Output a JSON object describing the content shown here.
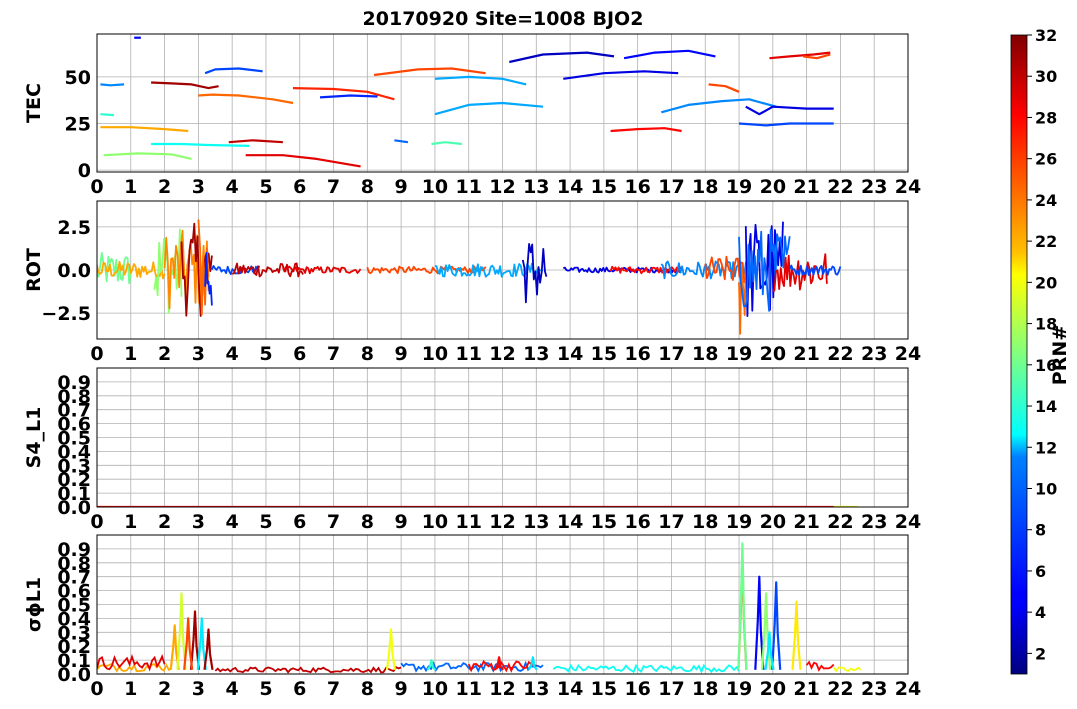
{
  "chart_data": {
    "type": "line",
    "title": "20170920 Site=1008 BJO2",
    "grid": true,
    "x_ticks": [
      "0",
      "1",
      "2",
      "3",
      "4",
      "5",
      "6",
      "7",
      "8",
      "9",
      "10",
      "11",
      "12",
      "13",
      "14",
      "15",
      "16",
      "17",
      "18",
      "19",
      "20",
      "21",
      "22",
      "23",
      "24"
    ],
    "xlim": [
      0,
      24
    ],
    "colorbar": {
      "label": "PRN#",
      "range": [
        1,
        32
      ],
      "colormap": "jet",
      "ticks": [
        "2",
        "4",
        "6",
        "8",
        "10",
        "12",
        "14",
        "16",
        "18",
        "20",
        "22",
        "24",
        "26",
        "28",
        "30",
        "32"
      ]
    },
    "panels": [
      {
        "ylabel": "TEC",
        "ylim": [
          -1,
          73
        ],
        "y_ticks": [
          {
            "v": 0,
            "t": "0"
          },
          {
            "v": 25,
            "t": "25"
          },
          {
            "v": 50,
            "t": "50"
          }
        ],
        "series": [
          {
            "prn": 5,
            "x": [
              1.1,
              1.3
            ],
            "y": [
              71,
              71
            ]
          },
          {
            "prn": 9,
            "x": [
              0.1,
              0.4,
              0.8
            ],
            "y": [
              46,
              45.5,
              46
            ]
          },
          {
            "prn": 31,
            "x": [
              1.6,
              2.2,
              2.8,
              3.3,
              3.6
            ],
            "y": [
              47,
              46.5,
              46,
              44,
              45
            ]
          },
          {
            "prn": 7,
            "x": [
              3.2,
              3.5,
              4.2,
              4.9
            ],
            "y": [
              52,
              54,
              54.5,
              53
            ]
          },
          {
            "prn": 25,
            "x": [
              3.0,
              3.4,
              4.2,
              5.2,
              5.8
            ],
            "y": [
              40,
              40.5,
              40,
              38,
              36
            ]
          },
          {
            "prn": 14,
            "x": [
              0.1,
              0.5
            ],
            "y": [
              30,
              29.5
            ]
          },
          {
            "prn": 23,
            "x": [
              0.1,
              1.0,
              2.0,
              2.7
            ],
            "y": [
              23,
              23,
              22,
              21
            ]
          },
          {
            "prn": 13,
            "x": [
              1.6,
              2.5,
              3.3,
              4.5
            ],
            "y": [
              14,
              14,
              13.5,
              13
            ]
          },
          {
            "prn": 17,
            "x": [
              0.2,
              1.2,
              2.2,
              2.8
            ],
            "y": [
              8,
              9,
              8.5,
              6
            ]
          },
          {
            "prn": 30,
            "x": [
              3.9,
              4.6,
              5.5
            ],
            "y": [
              15,
              16,
              15
            ]
          },
          {
            "prn": 29,
            "x": [
              4.4,
              5.5,
              6.5,
              7.8
            ],
            "y": [
              8,
              8,
              6,
              2
            ]
          },
          {
            "prn": 27,
            "x": [
              5.8,
              7.0,
              8.0,
              8.8
            ],
            "y": [
              44,
              43.5,
              42,
              38
            ]
          },
          {
            "prn": 6,
            "x": [
              6.6,
              7.5,
              8.3
            ],
            "y": [
              39,
              40,
              39.5
            ]
          },
          {
            "prn": 26,
            "x": [
              8.2,
              9.5,
              10.5,
              11.5
            ],
            "y": [
              51,
              54,
              54.5,
              52
            ]
          },
          {
            "prn": 10,
            "x": [
              10.0,
              11.0,
              12.0,
              12.7
            ],
            "y": [
              49,
              50,
              49,
              46
            ]
          },
          {
            "prn": 3,
            "x": [
              12.2,
              13.2,
              14.5,
              15.3
            ],
            "y": [
              58,
              62,
              63,
              61
            ]
          },
          {
            "prn": 5,
            "x": [
              15.6,
              16.5,
              17.5,
              18.3
            ],
            "y": [
              60,
              63,
              64,
              61
            ]
          },
          {
            "prn": 4,
            "x": [
              13.8,
              15.0,
              16.2,
              17.2
            ],
            "y": [
              49,
              52,
              53,
              52
            ]
          },
          {
            "prn": 10,
            "x": [
              10.0,
              11.0,
              12.0,
              13.2
            ],
            "y": [
              30,
              35,
              36,
              34
            ]
          },
          {
            "prn": 8,
            "x": [
              8.8,
              9.2
            ],
            "y": [
              16,
              15
            ]
          },
          {
            "prn": 15,
            "x": [
              9.9,
              10.3,
              10.8
            ],
            "y": [
              14,
              15,
              14
            ]
          },
          {
            "prn": 28,
            "x": [
              15.2,
              16.0,
              16.8,
              17.3
            ],
            "y": [
              21,
              22,
              22.5,
              21
            ]
          },
          {
            "prn": 26,
            "x": [
              18.1,
              18.6,
              19.0
            ],
            "y": [
              46,
              45,
              42
            ]
          },
          {
            "prn": 9,
            "x": [
              16.7,
              17.5,
              18.5,
              19.3,
              20.1
            ],
            "y": [
              31,
              35,
              37,
              38,
              34
            ]
          },
          {
            "prn": 4,
            "x": [
              19.2,
              19.6,
              20.0,
              21.0,
              21.8
            ],
            "y": [
              34,
              30,
              34,
              33,
              33
            ]
          },
          {
            "prn": 7,
            "x": [
              19.0,
              19.8,
              20.5,
              21.8
            ],
            "y": [
              25,
              24,
              25,
              25
            ]
          },
          {
            "prn": 29,
            "x": [
              19.9,
              20.5,
              21.2,
              21.7
            ],
            "y": [
              60,
              61,
              62,
              63
            ]
          },
          {
            "prn": 26,
            "x": [
              20.9,
              21.3,
              21.7
            ],
            "y": [
              61,
              60,
              62
            ]
          }
        ]
      },
      {
        "ylabel": "ROT",
        "ylim": [
          -4.0,
          4.0
        ],
        "y_ticks": [
          {
            "v": -2.5,
            "t": "−2.5"
          },
          {
            "v": 0,
            "t": "0.0"
          },
          {
            "v": 2.5,
            "t": "2.5"
          }
        ],
        "bursts": [
          {
            "prn": 16,
            "x": [
              0.0,
              1.0
            ],
            "amp": 1.0
          },
          {
            "prn": 23,
            "x": [
              0.0,
              2.0
            ],
            "amp": 0.5
          },
          {
            "prn": 17,
            "x": [
              1.7,
              2.5
            ],
            "amp": 2.6
          },
          {
            "prn": 24,
            "x": [
              2.0,
              3.3
            ],
            "amp": 2.3
          },
          {
            "prn": 31,
            "x": [
              2.5,
              3.4
            ],
            "amp": 2.7
          },
          {
            "prn": 25,
            "x": [
              3.0,
              3.3
            ],
            "amp": 3.5
          },
          {
            "prn": 6,
            "x": [
              3.2,
              3.4
            ],
            "amp": 2.7
          },
          {
            "prn": 7,
            "x": [
              3.4,
              4.8
            ],
            "amp": 0.25
          },
          {
            "prn": 30,
            "x": [
              4.0,
              6.1
            ],
            "amp": 0.4
          },
          {
            "prn": 29,
            "x": [
              5.5,
              7.8
            ],
            "amp": 0.2
          },
          {
            "prn": 26,
            "x": [
              8.0,
              11.5
            ],
            "amp": 0.2
          },
          {
            "prn": 10,
            "x": [
              10.0,
              13.2
            ],
            "amp": 0.4
          },
          {
            "prn": 3,
            "x": [
              12.6,
              13.3
            ],
            "amp": 2.0
          },
          {
            "prn": 4,
            "x": [
              13.8,
              17.3
            ],
            "amp": 0.15
          },
          {
            "prn": 28,
            "x": [
              15.2,
              17.3
            ],
            "amp": 0.2
          },
          {
            "prn": 9,
            "x": [
              16.7,
              19.3
            ],
            "amp": 0.5
          },
          {
            "prn": 26,
            "x": [
              18.0,
              19.3
            ],
            "amp": 0.8
          },
          {
            "prn": 25,
            "x": [
              19.0,
              19.2
            ],
            "amp": 4.5
          },
          {
            "prn": 4,
            "x": [
              19.2,
              20.3
            ],
            "amp": 3.0
          },
          {
            "prn": 8,
            "x": [
              19.0,
              20.5
            ],
            "amp": 2.5
          },
          {
            "prn": 29,
            "x": [
              20.0,
              21.6
            ],
            "amp": 1.2
          },
          {
            "prn": 7,
            "x": [
              20.5,
              22.0
            ],
            "amp": 0.3
          }
        ]
      },
      {
        "ylabel": "S4_L1",
        "ylim": [
          0,
          1.0
        ],
        "y_ticks": [
          {
            "v": 0.0,
            "t": "0.0"
          },
          {
            "v": 0.1,
            "t": "0.1"
          },
          {
            "v": 0.2,
            "t": "0.2"
          },
          {
            "v": 0.3,
            "t": "0.3"
          },
          {
            "v": 0.4,
            "t": "0.4"
          },
          {
            "v": 0.5,
            "t": "0.5"
          },
          {
            "v": 0.6,
            "t": "0.6"
          },
          {
            "v": 0.7,
            "t": "0.7"
          },
          {
            "v": 0.8,
            "t": "0.8"
          },
          {
            "v": 0.9,
            "t": "0.9"
          }
        ],
        "series": [
          {
            "prn": 28,
            "x": [
              0.0,
              21.8
            ],
            "y": [
              0.0,
              0.0
            ]
          },
          {
            "prn": 20,
            "x": [
              21.8,
              22.5
            ],
            "y": [
              0.0,
              0.0
            ]
          }
        ]
      },
      {
        "ylabel": "σϕL1",
        "ylim": [
          0,
          1.0
        ],
        "y_ticks": [
          {
            "v": 0.0,
            "t": "0.0"
          },
          {
            "v": 0.1,
            "t": "0.1"
          },
          {
            "v": 0.2,
            "t": "0.2"
          },
          {
            "v": 0.3,
            "t": "0.3"
          },
          {
            "v": 0.4,
            "t": "0.4"
          },
          {
            "v": 0.5,
            "t": "0.5"
          },
          {
            "v": 0.6,
            "t": "0.6"
          },
          {
            "v": 0.7,
            "t": "0.7"
          },
          {
            "v": 0.8,
            "t": "0.8"
          },
          {
            "v": 0.9,
            "t": "0.9"
          }
        ],
        "baseline": [
          {
            "prn": 23,
            "x": [
              0.0,
              2.2
            ],
            "y": 0.05
          },
          {
            "prn": 29,
            "x": [
              0.0,
              2.0
            ],
            "y": 0.08
          },
          {
            "prn": 30,
            "x": [
              3.5,
              9.0
            ],
            "y": 0.03
          },
          {
            "prn": 8,
            "x": [
              9.0,
              13.2
            ],
            "y": 0.05
          },
          {
            "prn": 28,
            "x": [
              11.0,
              13.0
            ],
            "y": 0.06
          },
          {
            "prn": 13,
            "x": [
              13.5,
              19.0
            ],
            "y": 0.04
          },
          {
            "prn": 28,
            "x": [
              21.0,
              21.8
            ],
            "y": 0.06
          },
          {
            "prn": 20,
            "x": [
              21.8,
              22.6
            ],
            "y": 0.03
          }
        ],
        "spikes": [
          {
            "prn": 23,
            "x": 2.3,
            "y": 0.35
          },
          {
            "prn": 19,
            "x": 2.5,
            "y": 0.58
          },
          {
            "prn": 31,
            "x": 2.9,
            "y": 0.45
          },
          {
            "prn": 26,
            "x": 2.7,
            "y": 0.4
          },
          {
            "prn": 12,
            "x": 3.1,
            "y": 0.4
          },
          {
            "prn": 31,
            "x": 3.3,
            "y": 0.32
          },
          {
            "prn": 20,
            "x": 8.7,
            "y": 0.32
          },
          {
            "prn": 14,
            "x": 9.9,
            "y": 0.1
          },
          {
            "prn": 28,
            "x": 11.9,
            "y": 0.12
          },
          {
            "prn": 12,
            "x": 12.9,
            "y": 0.12
          },
          {
            "prn": 25,
            "x": 19.1,
            "y": 0.85
          },
          {
            "prn": 16,
            "x": 19.1,
            "y": 0.94
          },
          {
            "prn": 5,
            "x": 19.6,
            "y": 0.7
          },
          {
            "prn": 17,
            "x": 19.8,
            "y": 0.58
          },
          {
            "prn": 7,
            "x": 20.1,
            "y": 0.66
          },
          {
            "prn": 12,
            "x": 19.9,
            "y": 0.3
          },
          {
            "prn": 21,
            "x": 20.7,
            "y": 0.52
          }
        ]
      }
    ]
  }
}
